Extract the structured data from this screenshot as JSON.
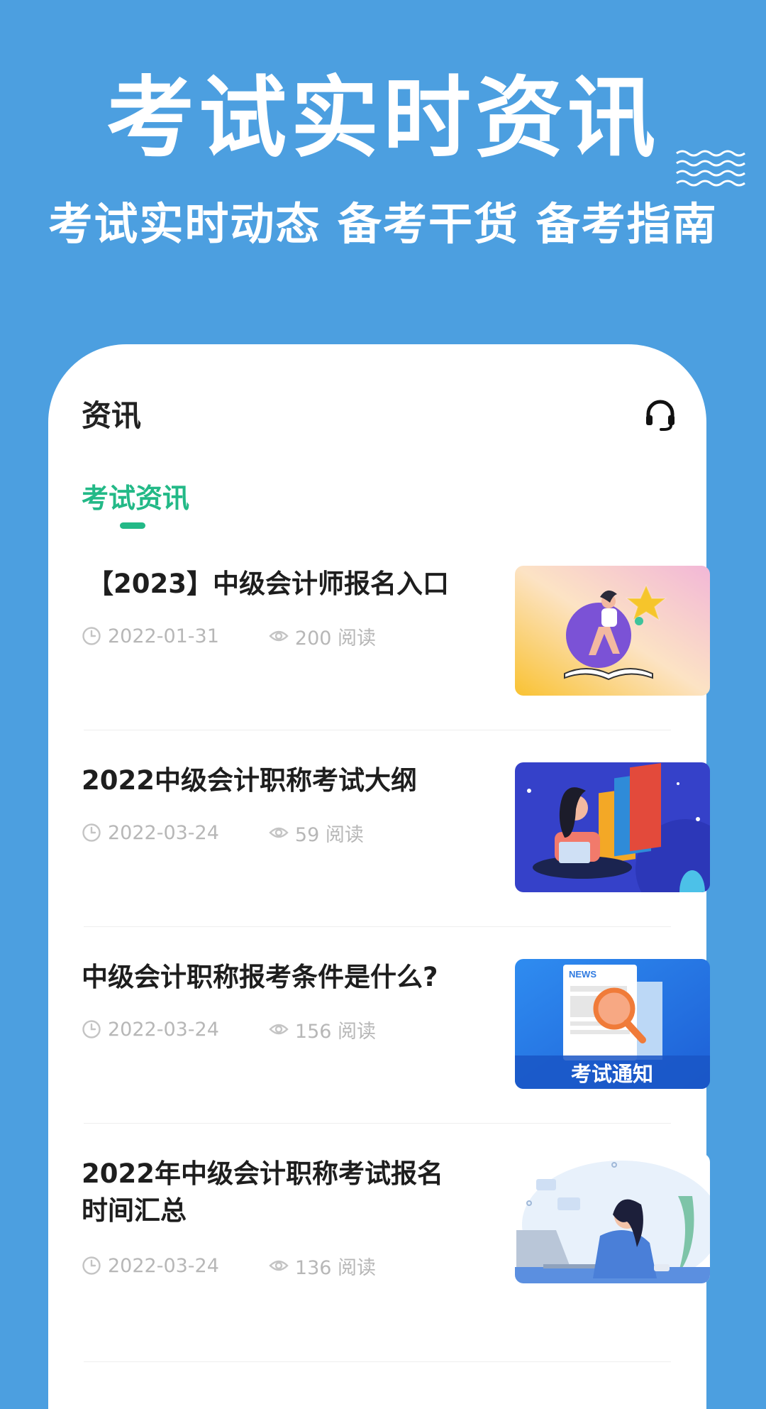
{
  "hero": {
    "title": "考试实时资讯",
    "subtitle": "考试实时动态  备考干货  备考指南"
  },
  "card": {
    "header_title": "资讯",
    "header_icon": "headset-icon",
    "tabs": [
      {
        "label": "考试资讯",
        "active": true
      }
    ],
    "accent_color": "#23b987"
  },
  "articles": [
    {
      "title": "【2023】中级会计师报名入口",
      "date": "2022-01-31",
      "views": "200 阅读",
      "thumb_theme": "woman-reading-star"
    },
    {
      "title": "2022中级会计职称考试大纲",
      "date": "2022-03-24",
      "views": "59 阅读",
      "thumb_theme": "woman-laptop-books"
    },
    {
      "title": "中级会计职称报考条件是什么?",
      "date": "2022-03-24",
      "views": "156 阅读",
      "thumb_theme": "news-magnifier",
      "thumb_caption": "考试通知",
      "thumb_tag": "NEWS"
    },
    {
      "title": "2022年中级会计职称考试报名时间汇总",
      "date": "2022-03-24",
      "views": "136 阅读",
      "thumb_theme": "woman-at-desk"
    }
  ]
}
